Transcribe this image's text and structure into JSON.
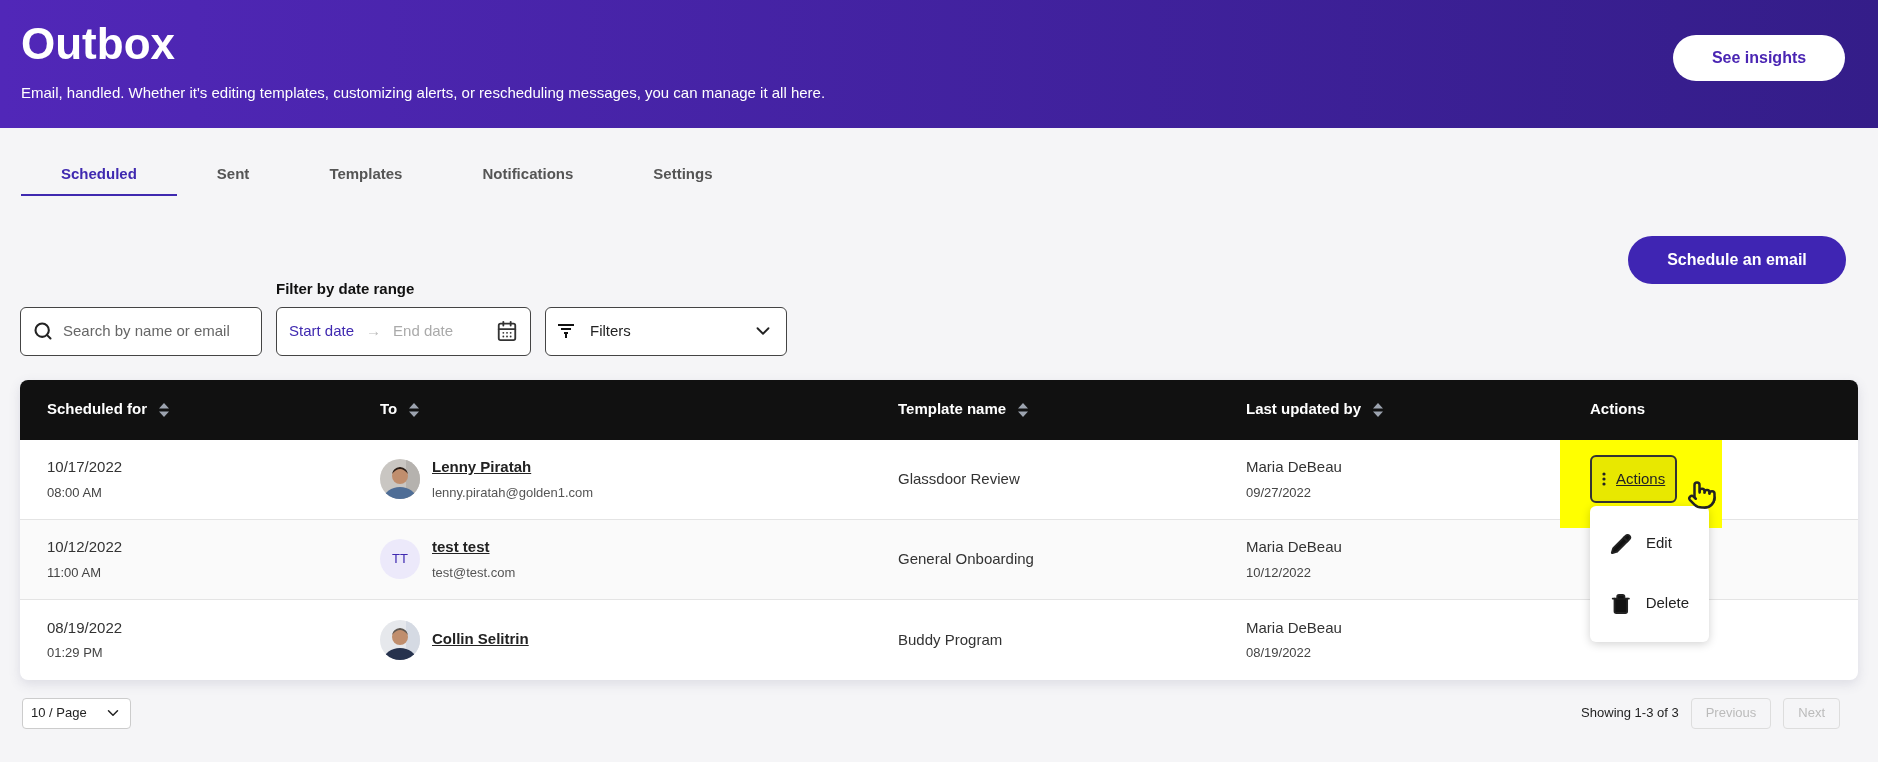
{
  "header": {
    "title": "Outbox",
    "subtitle": "Email, handled. Whether it's editing templates, customizing alerts, or rescheduling messages, you can manage it all here.",
    "button": "See insights"
  },
  "tabs": [
    {
      "label": "Scheduled",
      "selected": true
    },
    {
      "label": "Sent",
      "selected": false
    },
    {
      "label": "Templates",
      "selected": false
    },
    {
      "label": "Notifications",
      "selected": false
    },
    {
      "label": "Settings",
      "selected": false
    }
  ],
  "schedule_button": "Schedule an email",
  "search": {
    "placeholder": "Search by name or email"
  },
  "date_filter": {
    "label": "Filter by date range",
    "start_placeholder": "Start date",
    "separator": "→",
    "end_placeholder": "End date"
  },
  "filters": {
    "label": "Filters"
  },
  "table": {
    "columns": [
      {
        "label": "Scheduled for",
        "sortable": true
      },
      {
        "label": "To",
        "sortable": true
      },
      {
        "label": "Template name",
        "sortable": true
      },
      {
        "label": "Last updated by",
        "sortable": true
      },
      {
        "label": "Actions",
        "sortable": false
      }
    ],
    "rows": [
      {
        "date": "10/17/2022",
        "time": "08:00 AM",
        "name": "Lenny Piratah",
        "email": "lenny.piratah@golden1.com",
        "template": "Glassdoor Review",
        "updated_by": "Maria DeBeau",
        "updated_on": "09/27/2022",
        "action": "Actions",
        "highlighted": true,
        "menu_open": true
      },
      {
        "date": "10/12/2022",
        "time": "11:00 AM",
        "avatar": {
          "kind": "initials",
          "text": "TT"
        },
        "name": "test test",
        "email": "test@test.com",
        "template": "General Onboarding",
        "updated_by": "Maria DeBeau",
        "updated_on": "10/12/2022",
        "highlighted": false,
        "menu_open": false
      },
      {
        "date": "08/19/2022",
        "time": "01:29 PM",
        "name": "Collin Selitrin",
        "template": "Buddy Program",
        "updated_by": "Maria DeBeau",
        "updated_on": "08/19/2022",
        "highlighted": false,
        "menu_open": false
      }
    ]
  },
  "action_menu": [
    {
      "label": "Edit",
      "kind": "edit"
    },
    {
      "label": "Delete",
      "kind": "delete"
    }
  ],
  "pagination": {
    "page_size": "10 / Page",
    "summary": "Showing 1-3 of 3",
    "previous": {
      "label": "Previous",
      "disabled": true
    },
    "next": {
      "label": "Next",
      "disabled": true
    }
  }
}
